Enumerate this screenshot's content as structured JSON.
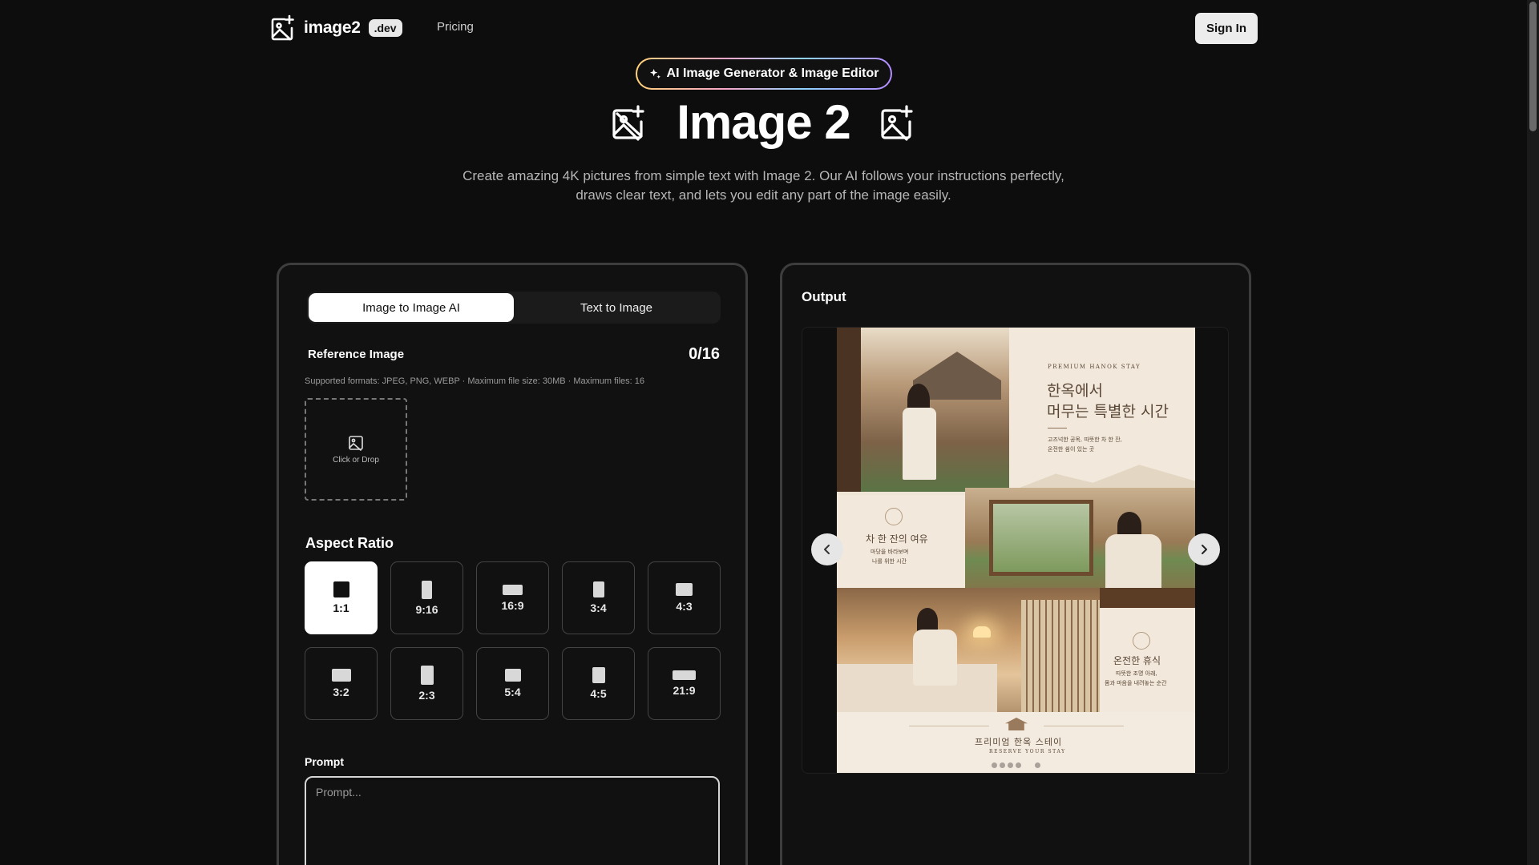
{
  "nav": {
    "brand": "image2",
    "badge": ".dev",
    "pricing": "Pricing",
    "sign_in": "Sign In"
  },
  "hero": {
    "pill": "AI Image Generator & Image Editor",
    "title": "Image 2",
    "subtitle_line1": "Create amazing 4K pictures from simple text with Image 2. Our AI follows your instructions perfectly,",
    "subtitle_line2": "draws clear text, and lets you edit any part of the image easily."
  },
  "left": {
    "tabs": [
      {
        "label": "Image to Image AI",
        "active": true
      },
      {
        "label": "Text to Image",
        "active": false
      }
    ],
    "reference_label": "Reference Image",
    "reference_count": "0/16",
    "formats": "Supported formats: JPEG, PNG, WEBP · Maximum file size: 30MB · Maximum files: 16",
    "dropzone_label": "Click or Drop",
    "aspect_label": "Aspect Ratio",
    "ratios": [
      {
        "label": "1:1",
        "active": true
      },
      {
        "label": "9:16",
        "active": false
      },
      {
        "label": "16:9",
        "active": false
      },
      {
        "label": "3:4",
        "active": false
      },
      {
        "label": "4:3",
        "active": false
      },
      {
        "label": "3:2",
        "active": false
      },
      {
        "label": "2:3",
        "active": false
      },
      {
        "label": "5:4",
        "active": false
      },
      {
        "label": "4:5",
        "active": false
      },
      {
        "label": "21:9",
        "active": false
      }
    ],
    "prompt_label": "Prompt",
    "prompt_placeholder": "Prompt..."
  },
  "right": {
    "output_label": "Output",
    "poster": {
      "eyebrow": "PREMIUM HANOK STAY",
      "headline1": "한옥에서",
      "headline2": "머무는 특별한 시간",
      "body1": "고즈넉한 공목, 따뜻한 차 한 잔,",
      "body2": "온전한 쉼이 있는 곳",
      "section1_title": "차 한 잔의 여유",
      "section1_line1": "마당을 바라보며",
      "section1_line2": "나를 위한 시간",
      "section2_title": "온전한 휴식",
      "section2_line1": "따뜻한 조명 아래,",
      "section2_line2": "몸과 마음을 내려놓는 순간",
      "footer_title": "프리미엄 한옥 스테이",
      "footer_sub": "RESERVE YOUR STAY"
    }
  },
  "colors": {
    "background": "#0d0d0d",
    "panel_border": "#3d3d3d",
    "accent_active": "#ffffff",
    "poster_bg": "#f2e9dc"
  }
}
